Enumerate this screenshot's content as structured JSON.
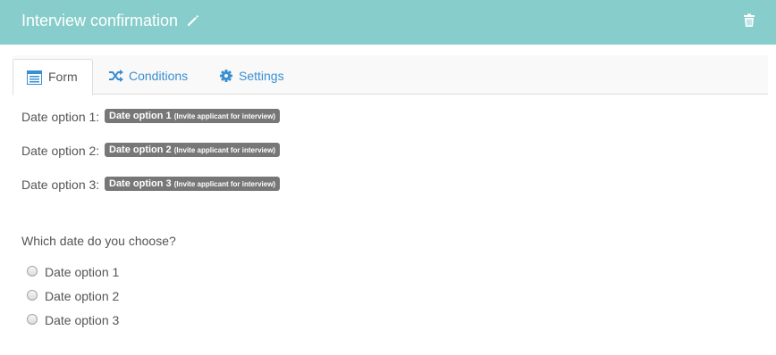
{
  "header": {
    "title": "Interview confirmation",
    "edit_icon": "pencil-icon",
    "delete_icon": "trash-icon",
    "background": "#86cdcb"
  },
  "tabs": [
    {
      "label": "Form",
      "icon": "form-icon",
      "active": true
    },
    {
      "label": "Conditions",
      "icon": "shuffle-icon",
      "active": false
    },
    {
      "label": "Settings",
      "icon": "gear-icon",
      "active": false
    }
  ],
  "date_options": [
    {
      "label": "Date option 1:",
      "tag": "Date option 1",
      "tag_note": "(Invite applicant for interview)"
    },
    {
      "label": "Date option 2:",
      "tag": "Date option 2",
      "tag_note": "(Invite applicant for interview)"
    },
    {
      "label": "Date option 3:",
      "tag": "Date option 3",
      "tag_note": "(Invite applicant for interview)"
    }
  ],
  "question": "Which date do you choose?",
  "choices": [
    {
      "label": "Date option 1",
      "selected": false
    },
    {
      "label": "Date option 2",
      "selected": false
    },
    {
      "label": "Date option 3",
      "selected": false
    }
  ],
  "colors": {
    "link": "#3a8fd1",
    "tag": "#777777",
    "text": "#555555"
  }
}
